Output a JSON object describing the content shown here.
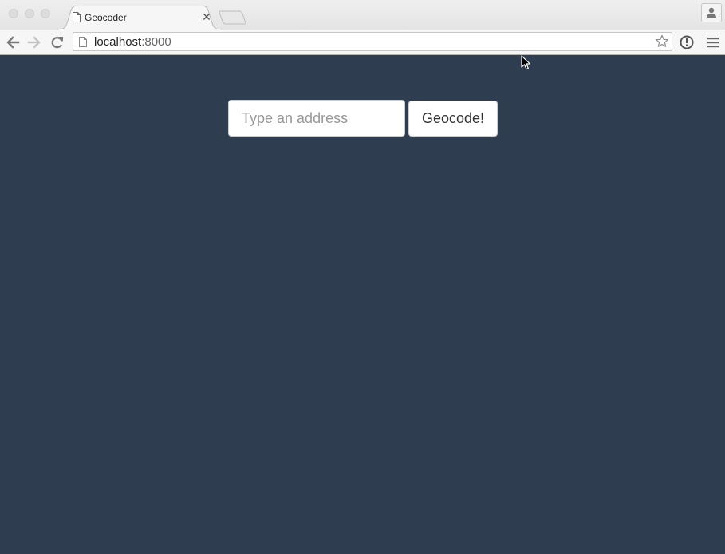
{
  "browser": {
    "tab": {
      "title": "Geocoder",
      "close_glyph": "✕",
      "favicon": "page-icon"
    },
    "omnibox": {
      "host": "localhost",
      "port": ":8000",
      "page_icon": "page-icon",
      "bookmark_icon": "star-icon"
    },
    "toolbar_icons": [
      "back-arrow-icon",
      "forward-arrow-icon",
      "reload-icon",
      "extension-icon",
      "menu-icon"
    ],
    "profile_icon": "person-icon"
  },
  "page": {
    "background_color": "#2e3e50",
    "search": {
      "placeholder": "Type an address",
      "value": ""
    },
    "geocode_button_label": "Geocode!"
  }
}
